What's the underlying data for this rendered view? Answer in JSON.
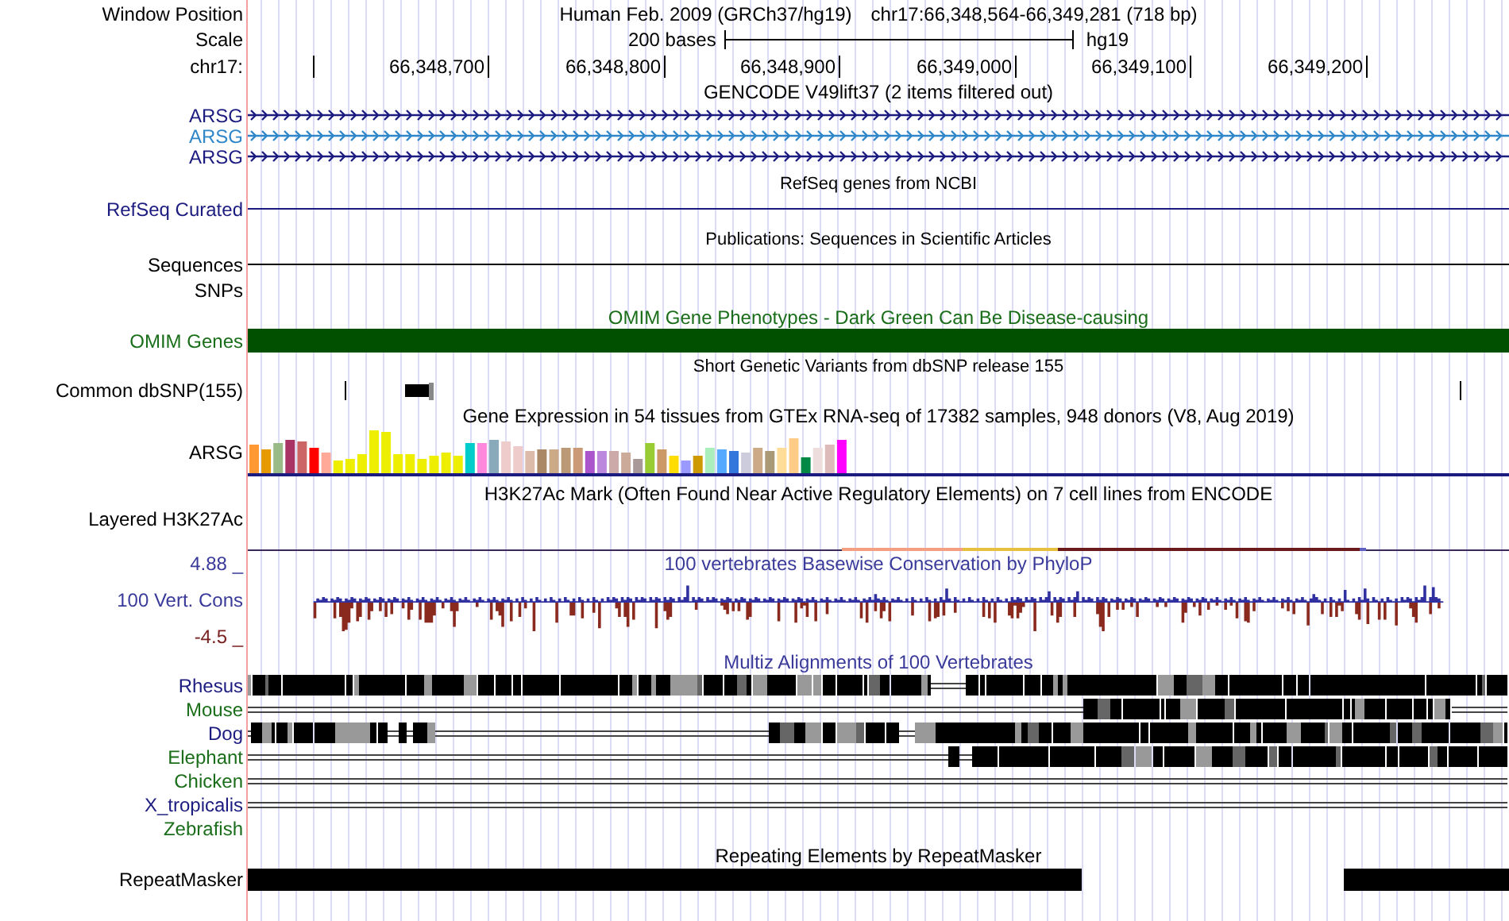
{
  "header": {
    "position_label": "Window Position",
    "assembly": "Human Feb. 2009 (GRCh37/hg19)",
    "position": "chr17:66,348,564-66,349,281 (718 bp)",
    "scale_label": "Scale",
    "scale_text": "200 bases",
    "scale_db": "hg19",
    "ruler_label": "chr17:",
    "ruler_ticks": [
      "66,348,700",
      "66,348,800",
      "66,348,900",
      "66,349,000",
      "66,349,100",
      "66,349,200"
    ]
  },
  "tracks": [
    {
      "kind": "genes",
      "title": "GENCODE V49lift37 (2 items filtered out)",
      "items": [
        {
          "label": "ARSG",
          "color": "#1c1c80"
        },
        {
          "label": "ARSG",
          "color": "#2f86c8"
        },
        {
          "label": "ARSG",
          "color": "#1c1c80"
        }
      ]
    },
    {
      "kind": "line",
      "title": "RefSeq genes from NCBI",
      "label": "RefSeq Curated",
      "color": "#1c1c80"
    },
    {
      "kind": "line",
      "title": "Publications: Sequences in Scientific Articles",
      "label": "Sequences",
      "color": "#000000"
    },
    {
      "kind": "empty",
      "label": "SNPs"
    },
    {
      "kind": "bar",
      "title": "OMIM Gene Phenotypes - Dark Green Can Be Disease-causing",
      "label": "OMIM Genes"
    },
    {
      "kind": "snp",
      "title": "Short Genetic Variants from dbSNP release 155",
      "label": "Common dbSNP(155)"
    },
    {
      "kind": "expression",
      "title": "Gene Expression in 54 tissues from GTEx RNA-seq of 17382 samples, 948 donors (V8, Aug 2019)",
      "label": "ARSG"
    },
    {
      "kind": "signal",
      "title": "H3K27Ac Mark (Often Found Near Active Regulatory Elements) on 7 cell lines from ENCODE",
      "label": "Layered H3K27Ac"
    },
    {
      "kind": "wiggle",
      "title": "100 vertebrates Basewise Conservation by PhyloP",
      "label": "100 Vert. Cons",
      "max": "4.88 _",
      "min": "-4.5 _"
    },
    {
      "kind": "alignment",
      "title": "Multiz Alignments of 100 Vertebrates",
      "items": [
        {
          "label": "Rhesus",
          "color": "#1c1c80"
        },
        {
          "label": "Mouse",
          "color": "#1a6e1a"
        },
        {
          "label": "Dog",
          "color": "#1c1c80"
        },
        {
          "label": "Elephant",
          "color": "#1a6e1a"
        },
        {
          "label": "Chicken",
          "color": "#1a6e1a"
        },
        {
          "label": "X_tropicalis",
          "color": "#1c1c80"
        },
        {
          "label": "Zebrafish",
          "color": "#1a6e1a"
        }
      ]
    },
    {
      "kind": "repeat",
      "title": "Repeating Elements by RepeatMasker",
      "label": "RepeatMasker"
    }
  ]
}
